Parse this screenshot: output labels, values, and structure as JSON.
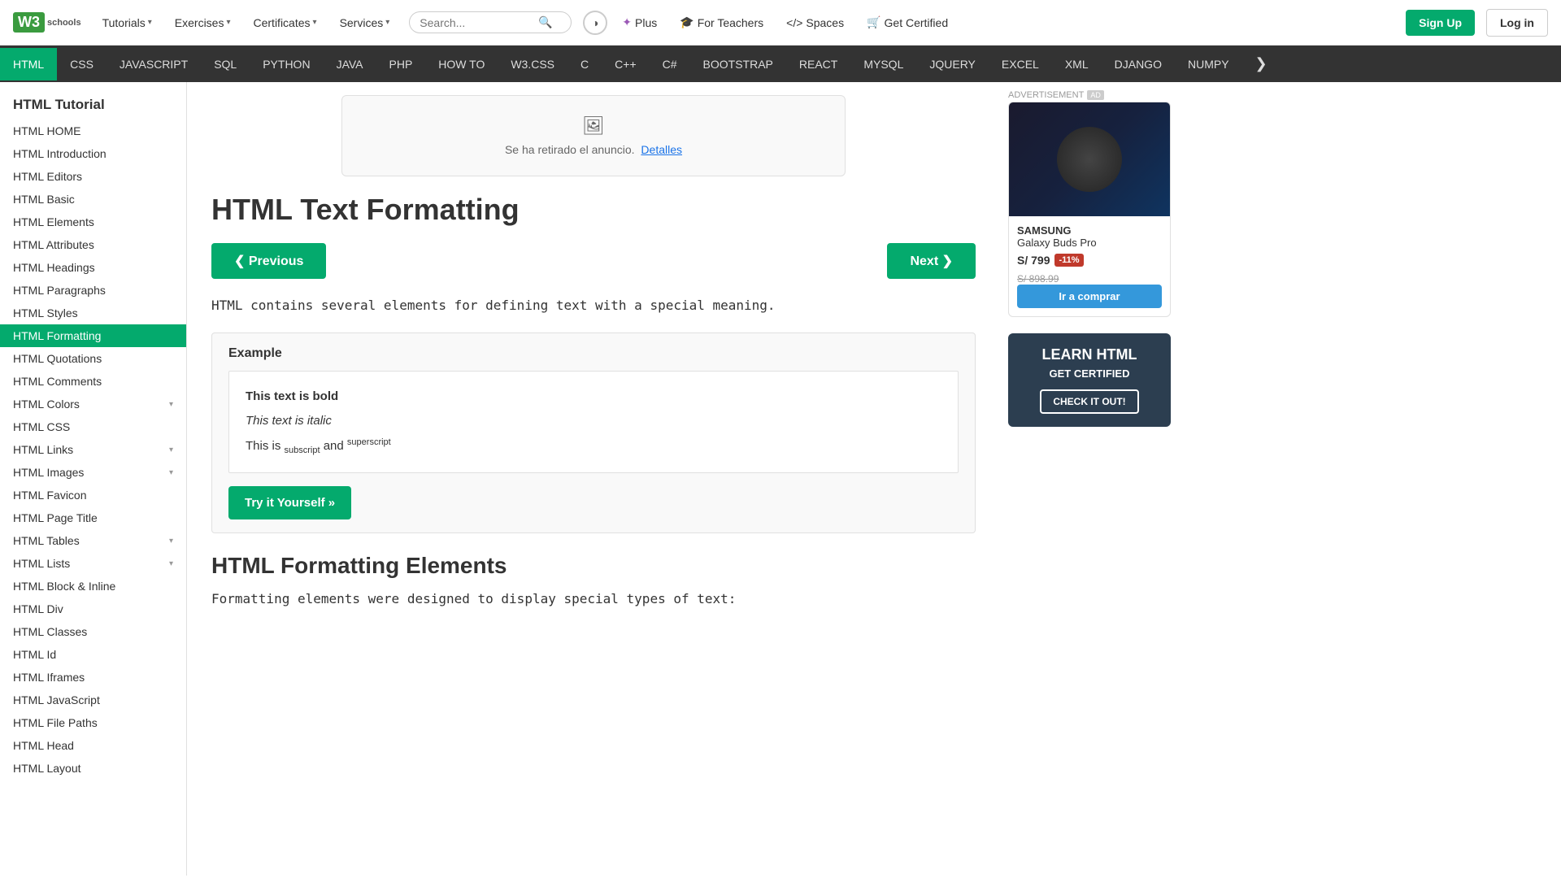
{
  "logo": {
    "w3": "W3",
    "schools": "schools"
  },
  "topnav": {
    "tutorials_label": "Tutorials",
    "exercises_label": "Exercises",
    "certificates_label": "Certificates",
    "services_label": "Services",
    "search_placeholder": "Search...",
    "plus_label": "Plus",
    "for_teachers_label": "For Teachers",
    "spaces_label": "Spaces",
    "get_certified_label": "Get Certified",
    "signup_label": "Sign Up",
    "login_label": "Log in"
  },
  "langbar": {
    "items": [
      "HTML",
      "CSS",
      "JAVASCRIPT",
      "SQL",
      "PYTHON",
      "JAVA",
      "PHP",
      "HOW TO",
      "W3.CSS",
      "C",
      "C++",
      "C#",
      "BOOTSTRAP",
      "REACT",
      "MYSQL",
      "JQUERY",
      "EXCEL",
      "XML",
      "DJANGO",
      "NUMPY"
    ],
    "active": "HTML",
    "more_icon": "❯"
  },
  "sidebar": {
    "title": "HTML Tutorial",
    "items": [
      {
        "label": "HTML HOME",
        "active": false
      },
      {
        "label": "HTML Introduction",
        "active": false
      },
      {
        "label": "HTML Editors",
        "active": false
      },
      {
        "label": "HTML Basic",
        "active": false
      },
      {
        "label": "HTML Elements",
        "active": false
      },
      {
        "label": "HTML Attributes",
        "active": false
      },
      {
        "label": "HTML Headings",
        "active": false
      },
      {
        "label": "HTML Paragraphs",
        "active": false
      },
      {
        "label": "HTML Styles",
        "active": false
      },
      {
        "label": "HTML Formatting",
        "active": true
      },
      {
        "label": "HTML Quotations",
        "active": false
      },
      {
        "label": "HTML Comments",
        "active": false
      },
      {
        "label": "HTML Colors",
        "active": false,
        "has_expand": true
      },
      {
        "label": "HTML CSS",
        "active": false
      },
      {
        "label": "HTML Links",
        "active": false,
        "has_expand": true
      },
      {
        "label": "HTML Images",
        "active": false,
        "has_expand": true
      },
      {
        "label": "HTML Favicon",
        "active": false
      },
      {
        "label": "HTML Page Title",
        "active": false
      },
      {
        "label": "HTML Tables",
        "active": false,
        "has_expand": true
      },
      {
        "label": "HTML Lists",
        "active": false,
        "has_expand": true
      },
      {
        "label": "HTML Block & Inline",
        "active": false
      },
      {
        "label": "HTML Div",
        "active": false
      },
      {
        "label": "HTML Classes",
        "active": false
      },
      {
        "label": "HTML Id",
        "active": false
      },
      {
        "label": "HTML Iframes",
        "active": false
      },
      {
        "label": "HTML JavaScript",
        "active": false
      },
      {
        "label": "HTML File Paths",
        "active": false
      },
      {
        "label": "HTML Head",
        "active": false
      },
      {
        "label": "HTML Layout",
        "active": false
      }
    ]
  },
  "content": {
    "ad_notice": "Se ha retirado el anuncio.",
    "ad_details_link": "Detalles",
    "page_title": "HTML Text Formatting",
    "prev_label": "❮ Previous",
    "next_label": "Next ❯",
    "description": "HTML contains several elements for defining text with a special meaning.",
    "example_label": "Example",
    "example_bold": "This text is bold",
    "example_italic": "This text is italic",
    "example_subscript_prefix": "This is ",
    "example_subscript_word": "subscript",
    "example_subscript_middle": " and ",
    "example_superscript_word": "superscript",
    "try_btn_label": "Try it Yourself »",
    "section_heading": "HTML Formatting Elements",
    "section_desc": "Formatting elements were designed to display special types of text:"
  },
  "right_panel": {
    "advertisement_label": "ADVERTISEMENT",
    "ad_badge": "AD",
    "brand_name": "SAMSUNG",
    "product_name": "Galaxy Buds Pro",
    "price": "S/ 799",
    "discount": "-11%",
    "original_price": "S/ 898.99",
    "buy_btn_label": "Ir a comprar",
    "learn_title": "LEARN HTML",
    "learn_sub": "GET CERTIFIED",
    "learn_btn": "CHECK IT OUT!"
  }
}
